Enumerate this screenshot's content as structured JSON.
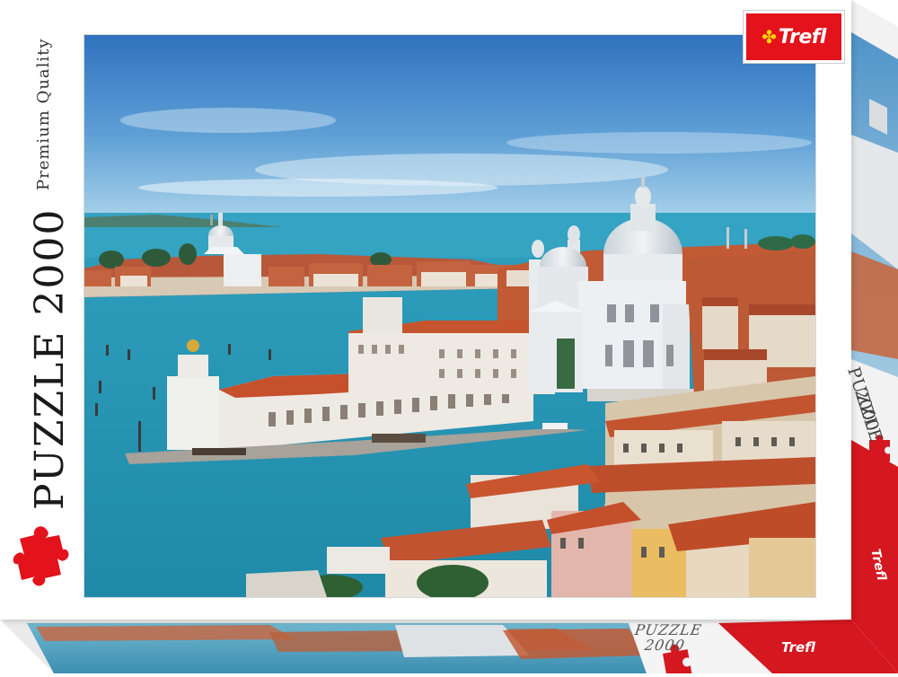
{
  "box": {
    "brand": "Trefl",
    "tagline": "Premium Quality",
    "product_title": "PUZZLE 2000",
    "side_line1": "PUZZLE",
    "side_line2": "2000",
    "bottom_line1": "PUZZLE",
    "bottom_line2": "2000",
    "bottom_brand": "Trefl",
    "side_brand": "Trefl"
  },
  "colors": {
    "brand_red": "#e3121b",
    "sky": "#3f86c9",
    "water": "#2b9bb3",
    "roof": "#c9572e",
    "basilica": "#e9edf0"
  },
  "icons": {
    "puzzle_piece": "puzzle-piece-icon",
    "logo_mark": "clover-icon"
  }
}
